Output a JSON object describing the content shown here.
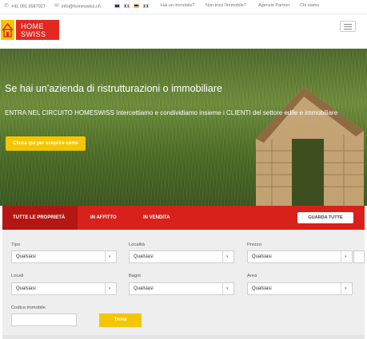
{
  "topbar": {
    "phone": "+41 091 3587027",
    "email": "info@homeswiss.ch",
    "languages": [
      "gb-flag-icon",
      "fr-flag-icon",
      "de-flag-icon",
      "it-flag-icon"
    ],
    "nav": [
      "Hai un immobile?",
      "Non trovi l'immobile?",
      "Agenzie Partner",
      "Chi siamo"
    ]
  },
  "logo": {
    "line1": "HOME",
    "line2": "SWISS"
  },
  "hero": {
    "title": "Se hai un'azienda di ristrutturazioni o immobiliare",
    "text": "ENTRA NEL CIRCUITO HOMESWISS Intercettiamo e condividiamo insieme i CLIENTI del settore edile e immobiliare",
    "cta": "Clicca qui per scoprire come"
  },
  "search": {
    "tabs": [
      "TUTTE LE PROPRIETÀ",
      "IN AFFITTO",
      "IN VENDITA"
    ],
    "view_all": "GUARDA TUTTE",
    "fields": {
      "tipo": {
        "label": "Tipo",
        "value": "Qualsiasi"
      },
      "localita": {
        "label": "Località",
        "value": "Qualsiasi"
      },
      "prezzo": {
        "label": "Prezzo",
        "value": "Qualsiasi"
      },
      "locali": {
        "label": "Locali",
        "value": "Qualsiasi"
      },
      "bagni": {
        "label": "Bagni",
        "value": "Qualsiasi"
      },
      "area": {
        "label": "Area",
        "value": "Qualsiasi"
      },
      "codice": {
        "label": "Codice immobile",
        "value": ""
      }
    },
    "submit": "Trova"
  },
  "colors": {
    "accent_red": "#d8211a",
    "accent_yellow": "#f4c600"
  }
}
